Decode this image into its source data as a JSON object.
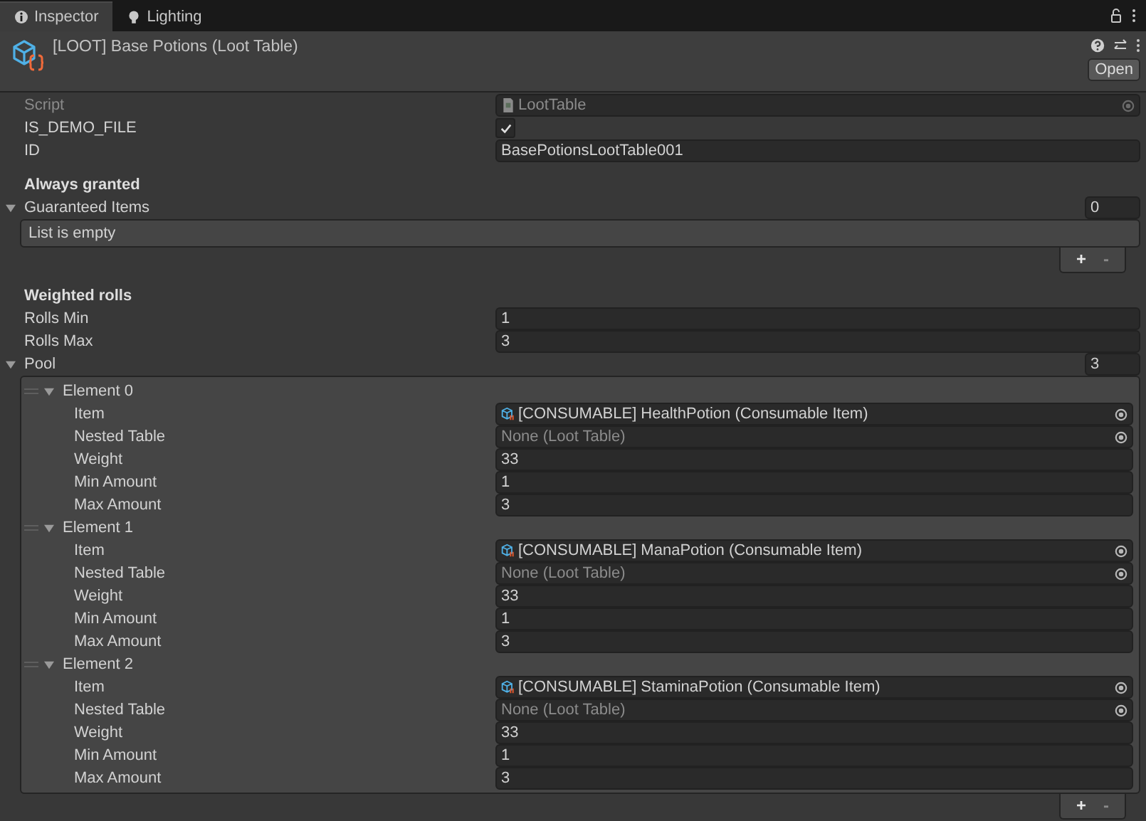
{
  "tabs": [
    {
      "label": "Inspector",
      "selected": true
    },
    {
      "label": "Lighting",
      "selected": false
    }
  ],
  "header": {
    "title": "[LOOT] Base Potions (Loot Table)",
    "open_button": "Open"
  },
  "rows": [
    {
      "kind": "script",
      "label": "Script",
      "value": "LootTable",
      "disabled": true
    },
    {
      "kind": "checkbox",
      "label": "IS_DEMO_FILE",
      "checked": true
    },
    {
      "kind": "text",
      "label": "ID",
      "value": "BasePotionsLootTable001"
    },
    {
      "kind": "heading",
      "label": "Always granted"
    },
    {
      "kind": "list",
      "label": "Guaranteed Items",
      "expanded": true,
      "size": "0",
      "empty_text": "List is empty",
      "add_button": "+",
      "remove_button": "-"
    },
    {
      "kind": "heading",
      "label": "Weighted rolls"
    },
    {
      "kind": "text",
      "label": "Rolls Min",
      "value": "1"
    },
    {
      "kind": "text",
      "label": "Rolls Max",
      "value": "3"
    },
    {
      "kind": "list",
      "label": "Pool",
      "expanded": true,
      "size": "3",
      "add_button": "+",
      "remove_button": "-",
      "elements": [
        {
          "label": "Element 0",
          "expanded": true,
          "fields": [
            {
              "kind": "object",
              "label": "Item",
              "value": "[CONSUMABLE] HealthPotion (Consumable Item)",
              "empty": false
            },
            {
              "kind": "object",
              "label": "Nested Table",
              "value": "None (Loot Table)",
              "empty": true
            },
            {
              "kind": "text",
              "label": "Weight",
              "value": "33"
            },
            {
              "kind": "text",
              "label": "Min Amount",
              "value": "1"
            },
            {
              "kind": "text",
              "label": "Max Amount",
              "value": "3"
            }
          ]
        },
        {
          "label": "Element 1",
          "expanded": true,
          "fields": [
            {
              "kind": "object",
              "label": "Item",
              "value": "[CONSUMABLE] ManaPotion (Consumable Item)",
              "empty": false
            },
            {
              "kind": "object",
              "label": "Nested Table",
              "value": "None (Loot Table)",
              "empty": true
            },
            {
              "kind": "text",
              "label": "Weight",
              "value": "33"
            },
            {
              "kind": "text",
              "label": "Min Amount",
              "value": "1"
            },
            {
              "kind": "text",
              "label": "Max Amount",
              "value": "3"
            }
          ]
        },
        {
          "label": "Element 2",
          "expanded": true,
          "fields": [
            {
              "kind": "object",
              "label": "Item",
              "value": "[CONSUMABLE] StaminaPotion (Consumable Item)",
              "empty": false
            },
            {
              "kind": "object",
              "label": "Nested Table",
              "value": "None (Loot Table)",
              "empty": true
            },
            {
              "kind": "text",
              "label": "Weight",
              "value": "33"
            },
            {
              "kind": "text",
              "label": "Min Amount",
              "value": "1"
            },
            {
              "kind": "text",
              "label": "Max Amount",
              "value": "3"
            }
          ]
        }
      ]
    }
  ]
}
